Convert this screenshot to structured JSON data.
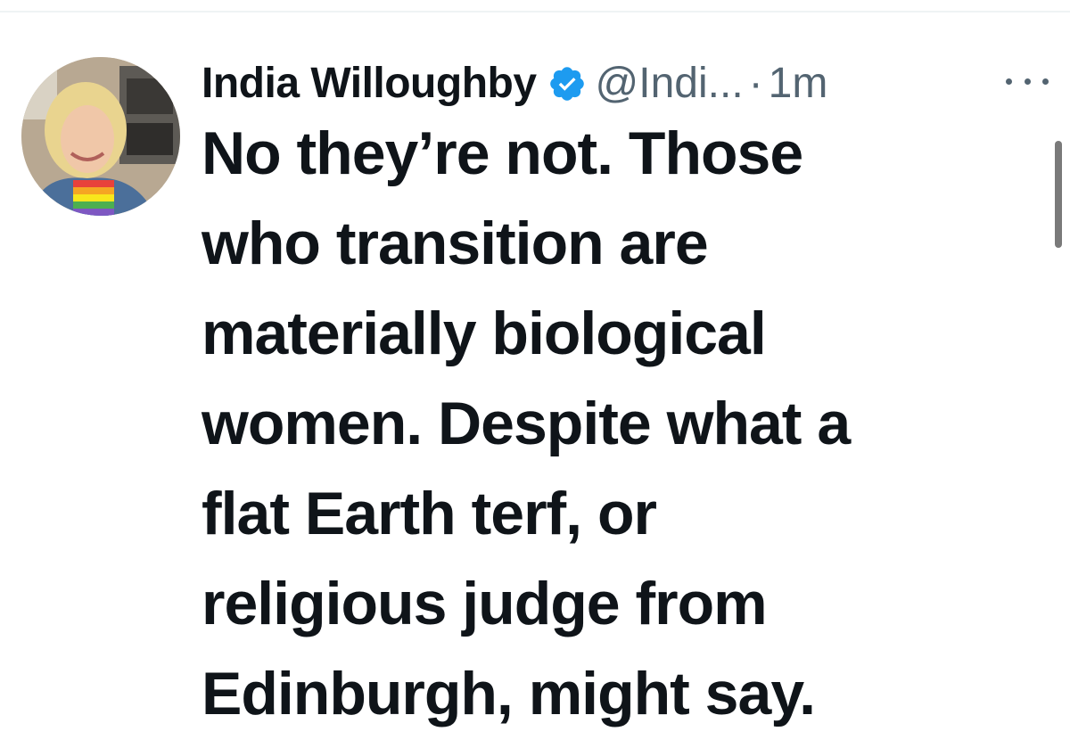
{
  "tweet": {
    "author": {
      "display_name": "India Willoughby",
      "handle": "@Indi...",
      "verified_icon": "verified-badge-icon",
      "verified_color": "#1d9bf0"
    },
    "separator": "·",
    "time": "1m",
    "more_icon": "more-horizontal-icon",
    "text": "No they’re not. Those\nwho transition are\nmaterially biological\nwomen. Despite what a\nflat Earth terf, or\nreligious judge from\nEdinburgh, might say."
  }
}
